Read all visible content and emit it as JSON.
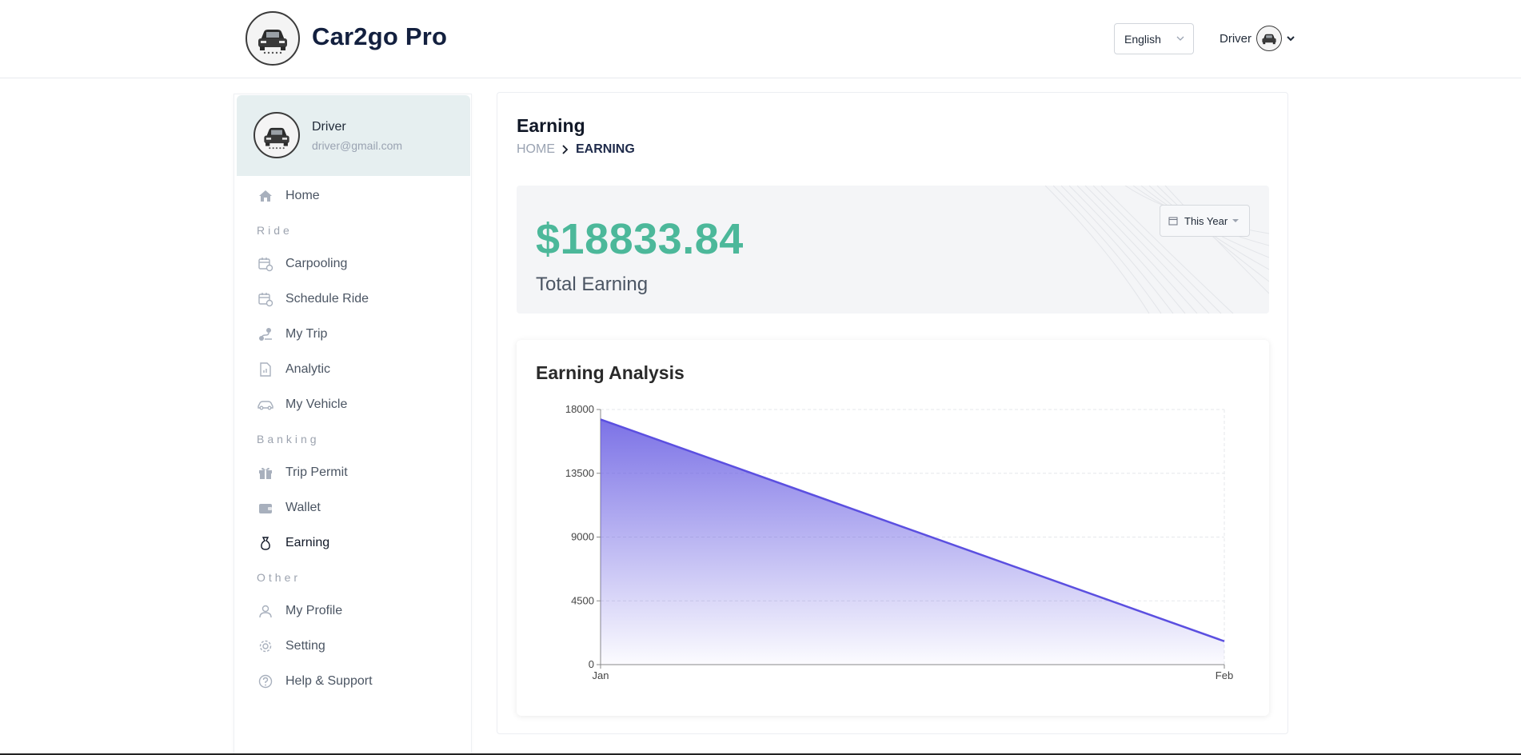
{
  "header": {
    "brand": "Car2go Pro",
    "language": "English",
    "user_label": "Driver"
  },
  "sidebar": {
    "profile": {
      "name": "Driver",
      "email": "driver@gmail.com"
    },
    "items": [
      {
        "label": "Home",
        "icon": "home-icon"
      },
      {
        "label": "Ride",
        "type": "section"
      },
      {
        "label": "Carpooling",
        "icon": "calendar-clock-icon"
      },
      {
        "label": "Schedule Ride",
        "icon": "calendar-clock-icon"
      },
      {
        "label": "My Trip",
        "icon": "route-icon"
      },
      {
        "label": "Analytic",
        "icon": "report-icon"
      },
      {
        "label": "My Vehicle",
        "icon": "car-icon"
      },
      {
        "label": "Banking",
        "type": "section"
      },
      {
        "label": "Trip Permit",
        "icon": "gift-icon"
      },
      {
        "label": "Wallet",
        "icon": "wallet-icon"
      },
      {
        "label": "Earning",
        "icon": "money-bag-icon",
        "active": true
      },
      {
        "label": "Other",
        "type": "section"
      },
      {
        "label": "My Profile",
        "icon": "user-icon"
      },
      {
        "label": "Setting",
        "icon": "gear-icon"
      },
      {
        "label": "Help & Support",
        "icon": "help-icon"
      }
    ]
  },
  "main": {
    "title": "Earning",
    "breadcrumb": {
      "home": "HOME",
      "current": "EARNING"
    },
    "total": {
      "amount": "$18833.84",
      "label": "Total Earning"
    },
    "period": "This Year",
    "chart_title": "Earning Analysis"
  },
  "colors": {
    "accent_green": "#4cb89a",
    "chart_line": "#5b4fe0",
    "brand_navy": "#13203f"
  },
  "chart_data": {
    "type": "area",
    "x": [
      "Jan",
      "Feb"
    ],
    "series": [
      {
        "values": [
          17300,
          1650
        ]
      }
    ],
    "ylim": [
      0,
      18000
    ],
    "yticks": [
      0,
      4500,
      9000,
      13500,
      18000
    ],
    "grid": true
  }
}
